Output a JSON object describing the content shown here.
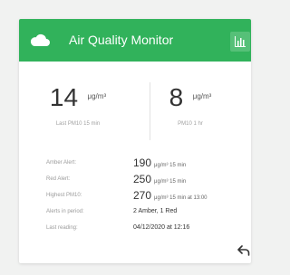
{
  "header": {
    "title": "Air Quality Monitor"
  },
  "metrics": [
    {
      "value": "14",
      "unit": "μg/m³",
      "label": "Last PM10 15 min"
    },
    {
      "value": "8",
      "unit": "μg/m³",
      "label": "PM10 1 hr"
    }
  ],
  "rows": [
    {
      "label": "Amber Alert:",
      "value": "190",
      "suffix": "μg/m³ 15 min"
    },
    {
      "label": "Red Alert:",
      "value": "250",
      "suffix": "μg/m³ 15 min"
    },
    {
      "label": "Highest PM10:",
      "value": "270",
      "suffix": "μg/m³ 15 min at 13:00"
    },
    {
      "label": "Alerts in period:",
      "text": "2 Amber, 1 Red"
    },
    {
      "label": "Last reading:",
      "text": "04/12/2020 at 12:16"
    }
  ],
  "icons": {
    "cloud": "cloud-icon",
    "chart": "bar-chart-icon",
    "back": "back-arrow-icon"
  },
  "colors": {
    "accent": "#31b25b"
  }
}
